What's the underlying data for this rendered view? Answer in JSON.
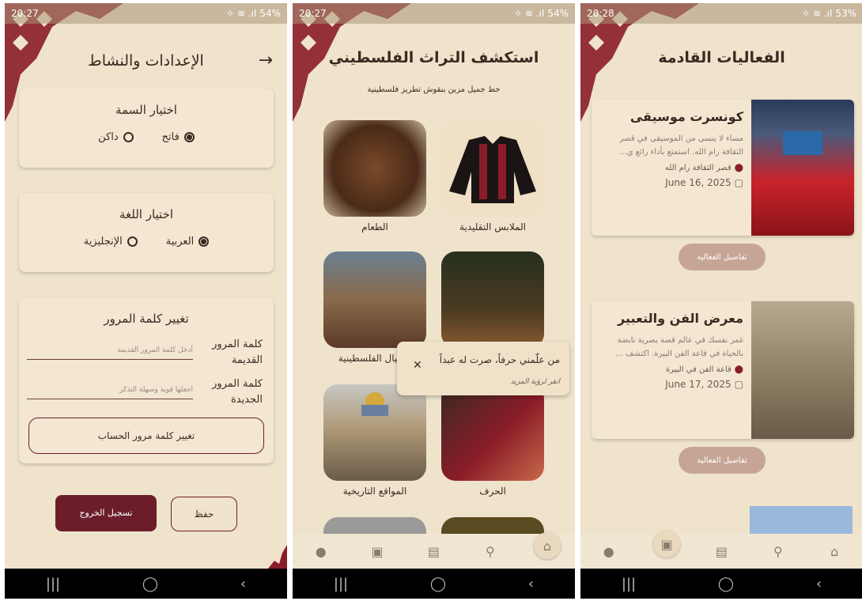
{
  "screen1": {
    "status": {
      "time": "20:27",
      "icons": "✧ ≋ .ıl",
      "battery": "54%"
    },
    "title": "الإعدادات والنشاط",
    "theme": {
      "heading": "اختيار السمة",
      "options": [
        "فاتح",
        "داكن"
      ],
      "selected": "فاتح"
    },
    "language": {
      "heading": "اختيار اللغة",
      "options": [
        "العربية",
        "الإنجليزية"
      ],
      "selected": "العربية"
    },
    "password": {
      "heading": "تغيير كلمة المرور",
      "old_label": "كلمة المرور القديمة",
      "old_placeholder": "أدخل كلمة المرور القديمة",
      "new_label": "كلمة المرور الجديدة",
      "new_placeholder": "اجعلها قوية وسهلة التذكر",
      "submit": "تغيير كلمة مرور الحساب"
    },
    "logout": "تسجيل الخروج",
    "save": "حفظ"
  },
  "screen2": {
    "status": {
      "time": "20:27",
      "icons": "✧ ≋ .ıl",
      "battery": "54%"
    },
    "title": "استكشف التراث الفلسطيني",
    "subtitle": "خط جميل مزين بنقوش تطريز فلسطينية",
    "tiles": [
      {
        "label": "الملابس التقليدية"
      },
      {
        "label": "الطعام"
      },
      {
        "label": ""
      },
      {
        "label": "الأجيال الفلسطينية"
      },
      {
        "label": "الحرف"
      },
      {
        "label": "المواقع التاريخية"
      }
    ],
    "toast": {
      "quote": "من علّمني حرفاً، صرت له عبداً",
      "hint": "انقر لرؤية المزيد"
    }
  },
  "screen3": {
    "status": {
      "time": "20:28",
      "icons": "✧ ≋ .ıl",
      "battery": "53%"
    },
    "title": "الفعاليات القادمة",
    "events": [
      {
        "title": "كونسرت موسيقى",
        "desc": "مساء لا ينسى من الموسيقى في قصر الثقافة رام الله. استمتع بأداء رائع ي...",
        "location": "قصر الثقافة رام الله",
        "date": "June 16, 2025",
        "button": "تفاصيل الفعالية"
      },
      {
        "title": "معرض الفن والتعبير",
        "desc": "غمر نفسك في عالم قصة بصرية نابضة بالحياة في قاعة الفن البيرة. اكتشف ...",
        "location": "قاعة الفن في البيرة",
        "date": "June 17, 2025",
        "button": "تفاصيل الفعالية"
      }
    ]
  },
  "colors": {
    "accent": "#6b1e2a",
    "background": "#efe3cc",
    "embroidery": "#8a1c28"
  }
}
